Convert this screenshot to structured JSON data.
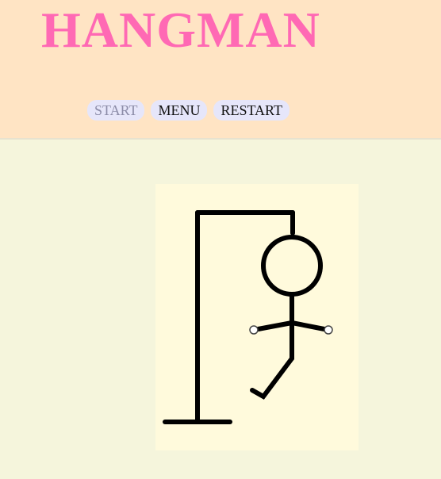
{
  "game": {
    "title": "HANGMAN"
  },
  "controls": {
    "start_label": "START",
    "menu_label": "MENU",
    "restart_label": "RESTART",
    "start_enabled": false
  },
  "gallows": {
    "parts_drawn": [
      "base",
      "pole",
      "beam",
      "rope",
      "head",
      "body",
      "arms",
      "left-leg"
    ],
    "line_color": "#000000"
  },
  "colors": {
    "title": "#ff69b4",
    "header_bg": "#ffe4c4",
    "page_bg": "#f5f5dc",
    "board_bg": "#fffadc",
    "button_bg": "#e6e6fa"
  }
}
